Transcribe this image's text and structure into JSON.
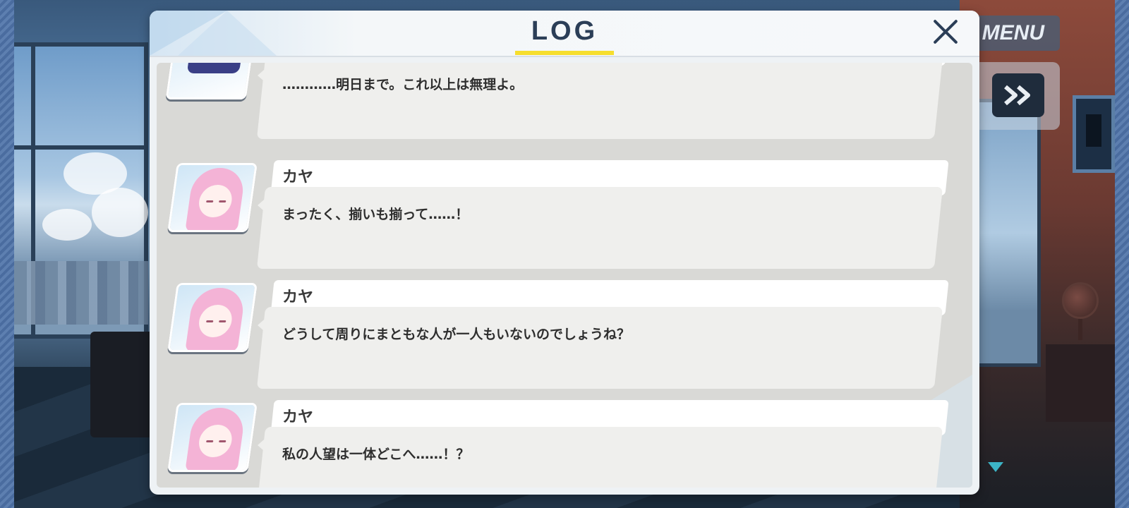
{
  "hud": {
    "menu_label": "MENU"
  },
  "log": {
    "title": "LOG",
    "entries": [
      {
        "speaker": "",
        "portrait": "purple-haired-student",
        "text": "…………明日まで。これ以上は無理よ。"
      },
      {
        "speaker": "カヤ",
        "portrait": "kaya",
        "text": "まったく、揃いも揃って……！"
      },
      {
        "speaker": "カヤ",
        "portrait": "kaya",
        "text": "どうして周りにまともな人が一人もいないのでしょうね？"
      },
      {
        "speaker": "カヤ",
        "portrait": "kaya",
        "text": "私の人望は一体どこへ……！？"
      }
    ]
  },
  "colors": {
    "title_underline": "#f6de2e",
    "title_text": "#2b3e57",
    "scroll_arrow": "#3cb4c6"
  }
}
